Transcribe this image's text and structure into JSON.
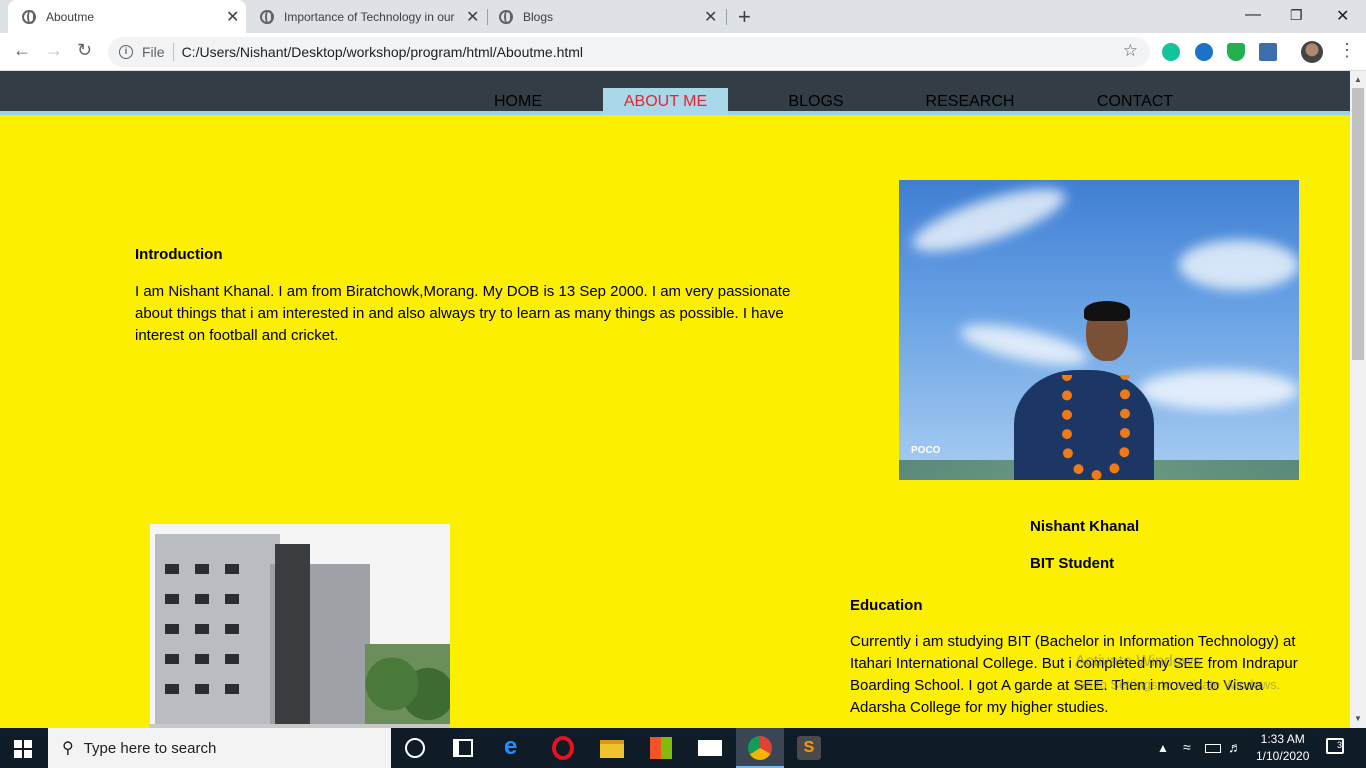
{
  "browser": {
    "tabs": [
      {
        "title": "Aboutme",
        "active": true
      },
      {
        "title": "Importance of Technology in our",
        "active": false
      },
      {
        "title": "Blogs",
        "active": false
      }
    ],
    "address": {
      "security_label": "File",
      "url": "C:/Users/Nishant/Desktop/workshop/program/html/Aboutme.html"
    },
    "extensions": [
      "grammarly-icon",
      "vpn-icon",
      "shield-icon",
      "screen-capture-icon"
    ]
  },
  "site": {
    "nav": [
      {
        "label": "HOME",
        "active": false
      },
      {
        "label": "ABOUT ME",
        "active": true
      },
      {
        "label": "BLOGS",
        "active": false
      },
      {
        "label": "RESEARCH",
        "active": false
      },
      {
        "label": "CONTACT",
        "active": false
      }
    ],
    "intro": {
      "heading": "Introduction",
      "text": "I am Nishant Khanal. I am from Biratchowk,Morang. My DOB is 13 Sep 2000. I am very passionate about things that i am interested in and also always try to learn as many things as possible. I have interest on football and cricket."
    },
    "profile": {
      "photo_caption": "POCO",
      "name": "Nishant Khanal",
      "role": "BIT Student"
    },
    "education": {
      "heading": "Education",
      "text": "Currently i am studying BIT (Bachelor in Information Technology) at Itahari International College. But i completed my SEE from Indrapur Boarding School. I got A garde at SEE. Then i moved to Viswa Adarsha College for my higher studies."
    },
    "watermark": {
      "line1": "Activate Windows",
      "line2": "Go to Settings to activate Windows."
    }
  },
  "taskbar": {
    "search_placeholder": "Type here to search",
    "time": "1:33 AM",
    "date": "1/10/2020",
    "notification_count": "3"
  },
  "colors": {
    "page_background": "#fdef00",
    "nav_background": "#323d45",
    "nav_active_background": "#a8d8ea",
    "nav_active_text": "#e8232f"
  }
}
